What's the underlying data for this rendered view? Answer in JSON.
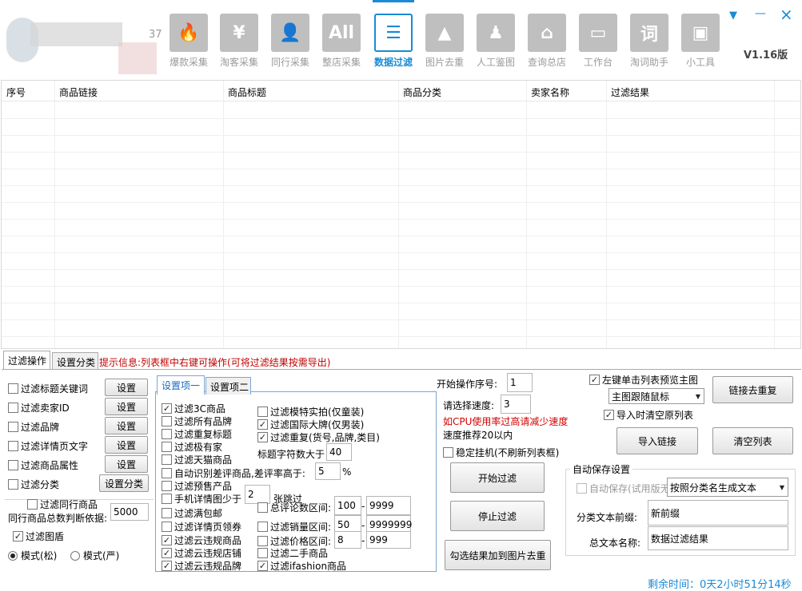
{
  "window": {
    "version": "V1.16版",
    "min_label": "—",
    "close_label": "×",
    "menu_label": "▼",
    "logo_digits": "37"
  },
  "toolbar": [
    {
      "label": "爆款采集",
      "glyph": "🔥",
      "icon": "fire-icon"
    },
    {
      "label": "淘客采集",
      "glyph": "¥",
      "icon": "yen-icon"
    },
    {
      "label": "同行采集",
      "glyph": "👤",
      "icon": "person-icon"
    },
    {
      "label": "整店采集",
      "glyph": "All",
      "icon": "all-icon"
    },
    {
      "label": "数据过滤",
      "glyph": "☰",
      "icon": "filter-list-icon"
    },
    {
      "label": "图片去重",
      "glyph": "▲",
      "icon": "image-icon"
    },
    {
      "label": "人工鉴图",
      "glyph": "♟",
      "icon": "sweep-icon"
    },
    {
      "label": "查询总店",
      "glyph": "⌂",
      "icon": "store-icon"
    },
    {
      "label": "工作台",
      "glyph": "▭",
      "icon": "monitor-icon"
    },
    {
      "label": "淘词助手",
      "glyph": "词",
      "icon": "word-icon"
    },
    {
      "label": "小工具",
      "glyph": "▣",
      "icon": "toolbox-icon"
    }
  ],
  "table": {
    "columns": [
      "序号",
      "商品链接",
      "商品标题",
      "商品分类",
      "卖家名称",
      "过滤结果"
    ]
  },
  "tabs": {
    "filter_op": "过滤操作",
    "set_category": "设置分类"
  },
  "hint": "提示信息:列表框中右键可操作(可将过滤结果按需导出)",
  "left": {
    "items": [
      "过滤标题关键词",
      "过滤卖家ID",
      "过滤品牌",
      "过滤详情页文字",
      "过滤商品属性",
      "过滤分类"
    ],
    "set": "设置",
    "set_category_btn": "设置分类",
    "peer": "过滤同行商品",
    "peer_total_label": "同行商品总数判断依据:",
    "peer_total_value": "5000",
    "shield": "过滤图盾",
    "mode_loose": "模式(松)",
    "mode_strict": "模式(严)"
  },
  "sub_tabs": {
    "one": "设置项一",
    "two": "设置项二"
  },
  "opts_col1": [
    {
      "label": "过滤3C商品",
      "checked": true
    },
    {
      "label": "过滤所有品牌",
      "checked": false
    },
    {
      "label": "过滤重复标题",
      "checked": false
    },
    {
      "label": "过滤极有家",
      "checked": false
    },
    {
      "label": "过滤天猫商品",
      "checked": false
    }
  ],
  "opts_col2": [
    {
      "label": "过滤模特实拍(仅童装)",
      "checked": false
    },
    {
      "label": "过滤国际大牌(仅男装)",
      "checked": true
    },
    {
      "label": "过滤重复(货号,品牌,类目)",
      "checked": true
    }
  ],
  "title_len_label": "标题字符数大于",
  "title_len_value": "40",
  "auto_bad": "自动识别差评商品,差评率高于:",
  "auto_bad_value": "5",
  "auto_bad_unit": "%",
  "presale": "过滤预售产品",
  "mobile_detail": "手机详情图少于",
  "mobile_detail_value": "2",
  "mobile_detail_unit": "张跳过",
  "free_ship": "过滤满包邮",
  "detail_coupon": "过滤详情页领券",
  "cloud_goods": "过滤云违规商品",
  "cloud_shop": "过滤云违规店铺",
  "cloud_brand": "过滤云违规品牌",
  "range_comment": {
    "label": "总评论数区间:",
    "min": "100",
    "max": "9999"
  },
  "range_sales": {
    "label": "过滤销量区间:",
    "min": "50",
    "max": "9999999"
  },
  "range_price": {
    "label": "过滤价格区间:",
    "min": "8",
    "max": "999"
  },
  "range_dash": "-",
  "second_hand": "过滤二手商品",
  "ifashion": "过滤ifashion商品",
  "mid": {
    "start_seq_label": "开始操作序号:",
    "start_seq": "1",
    "speed_label": "请选择速度:",
    "speed": "3",
    "cpu_warn": "如CPU使用率过高请减少速度",
    "speed_tip": "速度推荐20以内",
    "stable": "稳定挂机(不刷新列表框)",
    "start_btn": "开始过滤",
    "stop_btn": "停止过滤",
    "add_btn": "勾选结果加到图片去重"
  },
  "right": {
    "left_click": "左键单击列表预览主图",
    "follow_mode": "主图跟随鼠标",
    "dedupe_btn": "链接去重复",
    "clear_on_import": "导入时清空原列表",
    "import_btn": "导入链接",
    "clear_btn": "清空列表",
    "autosave_group": "自动保存设置",
    "autosave": "自动保存(试用版无",
    "autosave_mode": "按照分类名生成文本",
    "prefix_label": "分类文本前缀:",
    "prefix_value": "新前缀",
    "total_name_label": "总文本名称:",
    "total_name_value": "数据过滤结果"
  },
  "remaining": "剩余时间：0天2小时51分14秒"
}
